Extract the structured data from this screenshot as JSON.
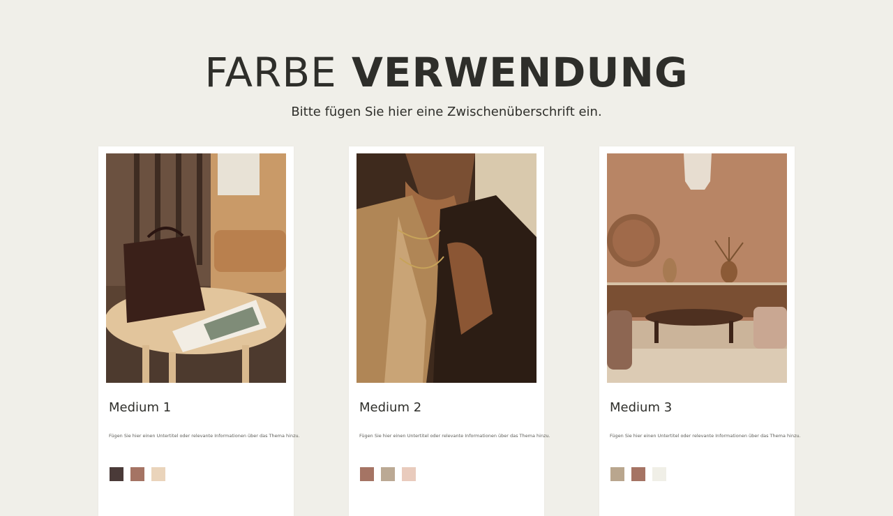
{
  "header": {
    "title_light": "FARBE",
    "title_bold": "VERWENDUNG",
    "subtitle": "Bitte fügen Sie hier eine Zwischenüberschrift ein."
  },
  "cards": [
    {
      "title": "Medium 1",
      "text": "Fügen Sie hier einen Untertitel oder relevante Informationen über das Thema hinzu.",
      "image": "leather-bag-on-side-table-photo",
      "swatches": [
        "#4a3a38",
        "#a57464",
        "#ead4bb"
      ]
    },
    {
      "title": "Medium 2",
      "text": "Fügen Sie hier einen Untertitel oder relevante Informationen über das Thema hinzu.",
      "image": "woman-in-blazer-photo",
      "swatches": [
        "#a57464",
        "#bba994",
        "#e9cbbd"
      ]
    },
    {
      "title": "Medium 3",
      "text": "Fügen Sie hier einen Untertitel oder relevante Informationen über das Thema hinzu.",
      "image": "terracotta-living-room-photo",
      "swatches": [
        "#b9a68e",
        "#a57464",
        "#f0efe7"
      ]
    }
  ]
}
